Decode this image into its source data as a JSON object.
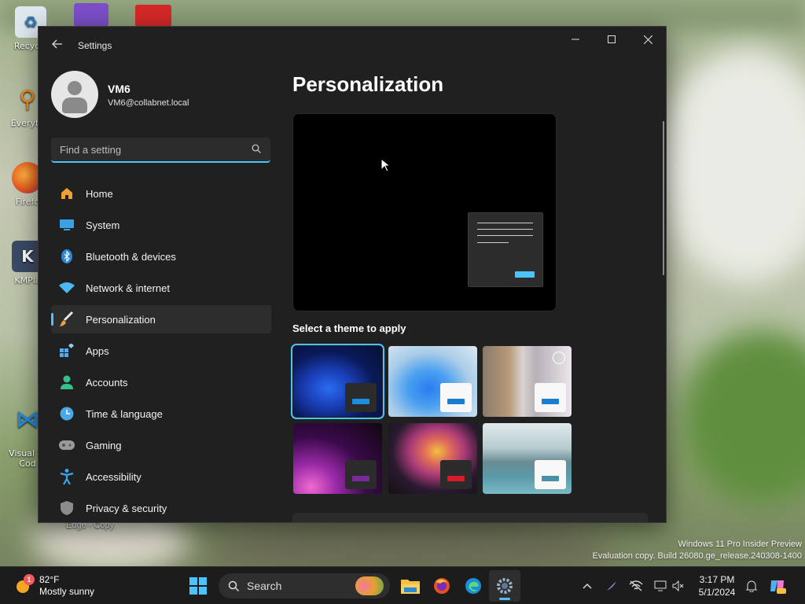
{
  "desktop": {
    "icons": [
      {
        "label": "Recycle",
        "icon": "recycle-bin-icon"
      },
      {
        "label": "Everyth",
        "icon": "everything-search-icon"
      },
      {
        "label": "Firefo",
        "icon": "firefox-icon"
      },
      {
        "label": "KMPla",
        "icon": "kmplayer-icon"
      },
      {
        "label": "Visual St\nCod",
        "icon": "vscode-icon"
      },
      {
        "label": "Edge - Copy",
        "icon": "edge-icon"
      }
    ],
    "watermark": {
      "line1": "Windows 11 Pro Insider Preview",
      "line2": "Evaluation copy. Build 26080.ge_release.240308-1400"
    }
  },
  "window": {
    "title": "Settings",
    "controls": {
      "minimize": "—",
      "maximize": "☐",
      "close": "✕"
    },
    "user": {
      "name": "VM6",
      "email": "VM6@collabnet.local"
    },
    "search": {
      "placeholder": "Find a setting"
    },
    "nav": [
      {
        "label": "Home",
        "icon": "home-icon",
        "active": false
      },
      {
        "label": "System",
        "icon": "system-icon",
        "active": false
      },
      {
        "label": "Bluetooth & devices",
        "icon": "bluetooth-icon",
        "active": false
      },
      {
        "label": "Network & internet",
        "icon": "network-icon",
        "active": false
      },
      {
        "label": "Personalization",
        "icon": "brush-icon",
        "active": true
      },
      {
        "label": "Apps",
        "icon": "apps-icon",
        "active": false
      },
      {
        "label": "Accounts",
        "icon": "accounts-icon",
        "active": false
      },
      {
        "label": "Time & language",
        "icon": "time-language-icon",
        "active": false
      },
      {
        "label": "Gaming",
        "icon": "gaming-icon",
        "active": false
      },
      {
        "label": "Accessibility",
        "icon": "accessibility-icon",
        "active": false
      },
      {
        "label": "Privacy & security",
        "icon": "shield-icon",
        "active": false
      }
    ],
    "content": {
      "title": "Personalization",
      "theme_label": "Select a theme to apply",
      "themes": [
        {
          "name": "windows-dark",
          "selected": true
        },
        {
          "name": "windows-light",
          "selected": false
        },
        {
          "name": "windows-spotlight",
          "selected": false
        },
        {
          "name": "glow",
          "selected": false
        },
        {
          "name": "captured-motion",
          "selected": false
        },
        {
          "name": "flow",
          "selected": false
        }
      ]
    }
  },
  "taskbar": {
    "weather": {
      "temp": "82°F",
      "condition": "Mostly sunny",
      "badge": "1"
    },
    "search_label": "Search",
    "apps": [
      "start-icon",
      "file-explorer-icon",
      "firefox-icon",
      "edge-icon",
      "settings-icon"
    ],
    "clock": {
      "time": "3:17 PM",
      "date": "5/1/2024"
    },
    "colors": {
      "accent": "#4cc2ff",
      "background": "#1c1c1c"
    }
  }
}
